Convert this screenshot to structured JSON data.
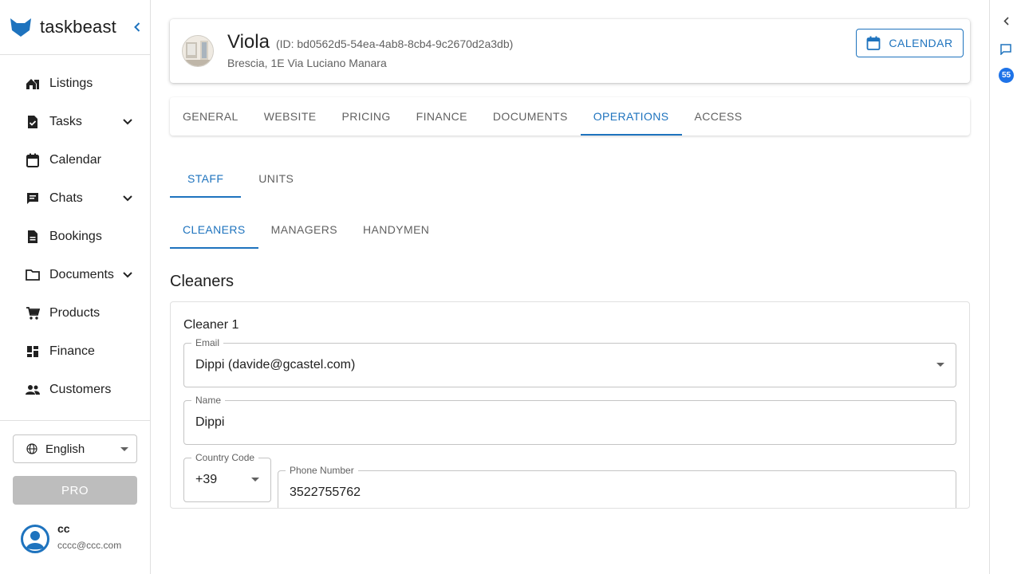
{
  "brand": {
    "name": "taskbeast"
  },
  "sidebar": {
    "items": [
      {
        "label": "Listings",
        "icon": "home-icon",
        "has_children": false
      },
      {
        "label": "Tasks",
        "icon": "task-icon",
        "has_children": true
      },
      {
        "label": "Calendar",
        "icon": "calendar-icon",
        "has_children": false
      },
      {
        "label": "Chats",
        "icon": "chat-icon",
        "has_children": true
      },
      {
        "label": "Bookings",
        "icon": "document-icon",
        "has_children": false
      },
      {
        "label": "Documents",
        "icon": "folder-icon",
        "has_children": true
      },
      {
        "label": "Products",
        "icon": "cart-icon",
        "has_children": false
      },
      {
        "label": "Finance",
        "icon": "dashboard-icon",
        "has_children": false
      },
      {
        "label": "Customers",
        "icon": "people-icon",
        "has_children": false
      }
    ],
    "language": "English",
    "pro_label": "PRO",
    "user": {
      "name": "cc",
      "email": "cccc@ccc.com"
    }
  },
  "rail": {
    "badge_count": "55"
  },
  "listing": {
    "name": "Viola",
    "id_text": "(ID: bd0562d5-54ea-4ab8-8cb4-9c2670d2a3db)",
    "address": "Brescia, 1E Via Luciano Manara",
    "calendar_button": "CALENDAR"
  },
  "tabs": [
    {
      "label": "GENERAL",
      "active": false
    },
    {
      "label": "WEBSITE",
      "active": false
    },
    {
      "label": "PRICING",
      "active": false
    },
    {
      "label": "FINANCE",
      "active": false
    },
    {
      "label": "DOCUMENTS",
      "active": false
    },
    {
      "label": "OPERATIONS",
      "active": true
    },
    {
      "label": "ACCESS",
      "active": false
    }
  ],
  "subtabs": [
    {
      "label": "STAFF",
      "active": true
    },
    {
      "label": "UNITS",
      "active": false
    }
  ],
  "staff_tabs": [
    {
      "label": "CLEANERS",
      "active": true
    },
    {
      "label": "MANAGERS",
      "active": false
    },
    {
      "label": "HANDYMEN",
      "active": false
    }
  ],
  "section": {
    "title": "Cleaners"
  },
  "cleaner": {
    "title": "Cleaner 1",
    "email_label": "Email",
    "email_value": "Dippi (davide@gcastel.com)",
    "name_label": "Name",
    "name_value": "Dippi",
    "country_code_label": "Country Code",
    "country_code_value": "+39",
    "phone_label": "Phone Number",
    "phone_value": "3522755762"
  },
  "colors": {
    "accent": "#1e73be",
    "badge": "#1e73e8",
    "brand_logo": "#1e73be"
  }
}
